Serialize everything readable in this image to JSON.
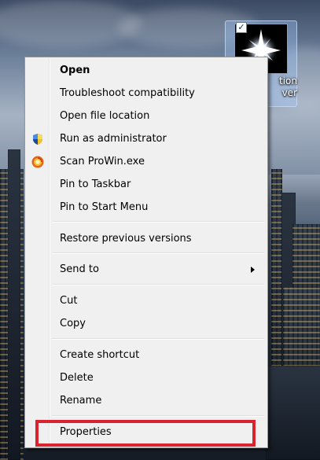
{
  "desktop_icon": {
    "label_line1": "tion",
    "label_line2": "ver",
    "icon": "starburst-icon",
    "checked": true
  },
  "context_menu": {
    "items": [
      {
        "label": "Open",
        "bold": true
      },
      {
        "label": "Troubleshoot compatibility"
      },
      {
        "label": "Open file location"
      },
      {
        "label": "Run as administrator",
        "icon": "uac-shield-icon"
      },
      {
        "label": "Scan ProWin.exe",
        "icon": "antivirus-icon"
      },
      {
        "label": "Pin to Taskbar"
      },
      {
        "label": "Pin to Start Menu"
      },
      {
        "label": "Restore previous versions"
      },
      {
        "label": "Send to",
        "has_submenu": true
      },
      {
        "label": "Cut"
      },
      {
        "label": "Copy"
      },
      {
        "label": "Create shortcut"
      },
      {
        "label": "Delete"
      },
      {
        "label": "Rename"
      },
      {
        "label": "Properties"
      }
    ]
  },
  "colors": {
    "menu_background": "#f0f0f0",
    "highlight_border": "#d9242f"
  }
}
